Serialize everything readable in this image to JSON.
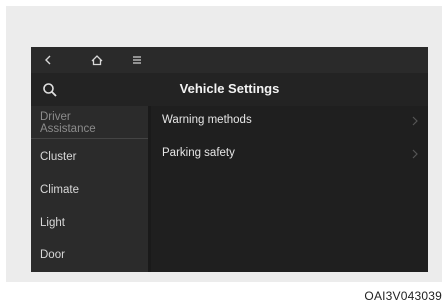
{
  "topbar": {
    "back_icon": "chevron-left-icon",
    "home_icon": "home-icon",
    "menu_icon": "hamburger-menu-icon"
  },
  "header": {
    "title": "Vehicle Settings",
    "search_icon": "search-icon"
  },
  "sidebar": {
    "items": [
      {
        "label": "Driver Assistance",
        "line1": "Driver",
        "line2": "Assistance",
        "active": true
      },
      {
        "label": "Cluster"
      },
      {
        "label": "Climate"
      },
      {
        "label": "Light"
      },
      {
        "label": "Door"
      }
    ]
  },
  "main": {
    "items": [
      {
        "label": "Warning methods"
      },
      {
        "label": "Parking safety"
      }
    ]
  },
  "caption": "OAI3V043039",
  "colors": {
    "screen_bg": "#1f1f1f",
    "sidebar_bg": "#2b2b2b",
    "text": "#e6e6e6",
    "muted_text": "#8c8c8c"
  }
}
